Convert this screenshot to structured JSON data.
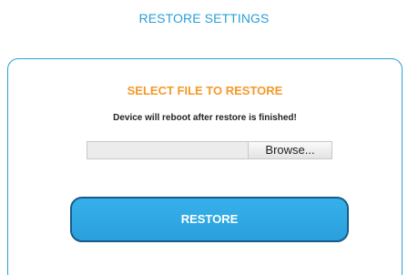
{
  "page": {
    "title": "RESTORE SETTINGS"
  },
  "card": {
    "title": "SELECT FILE TO RESTORE",
    "note": "Device will reboot after restore is finished!",
    "file_input": {
      "value": "",
      "browse_label": "Browse..."
    },
    "restore_label": "RESTORE"
  },
  "colors": {
    "accent": "#2a9fd6",
    "heading_orange": "#f39a2b",
    "button_border": "#1a5a8a"
  }
}
